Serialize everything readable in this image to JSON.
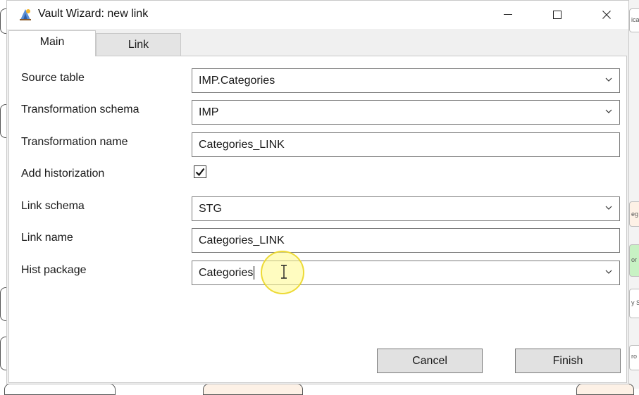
{
  "window": {
    "title": "Vault Wizard: new link",
    "controls": {
      "minimize_icon": "minimize-icon",
      "maximize_icon": "maximize-icon",
      "close_icon": "close-icon"
    }
  },
  "tabs": [
    {
      "label": "Main",
      "active": true
    },
    {
      "label": "Link",
      "active": false
    }
  ],
  "form": {
    "source_table": {
      "label": "Source table",
      "value": "IMP.Categories"
    },
    "transformation_schema": {
      "label": "Transformation schema",
      "value": "IMP"
    },
    "transformation_name": {
      "label": "Transformation name",
      "value": "Categories_LINK"
    },
    "add_historization": {
      "label": "Add historization",
      "checked": true
    },
    "link_schema": {
      "label": "Link schema",
      "value": "STG"
    },
    "link_name": {
      "label": "Link name",
      "value": "Categories_LINK"
    },
    "hist_package": {
      "label": "Hist package",
      "value": "Categories"
    }
  },
  "buttons": {
    "cancel": "Cancel",
    "finish": "Finish"
  },
  "background_cards": [
    "ica",
    "eg",
    "or",
    "y S",
    "ro"
  ],
  "colors": {
    "accent_highlight": "#fff98c",
    "button_bg": "#e1e1e1",
    "highlight_card": "#c8f2c4"
  }
}
